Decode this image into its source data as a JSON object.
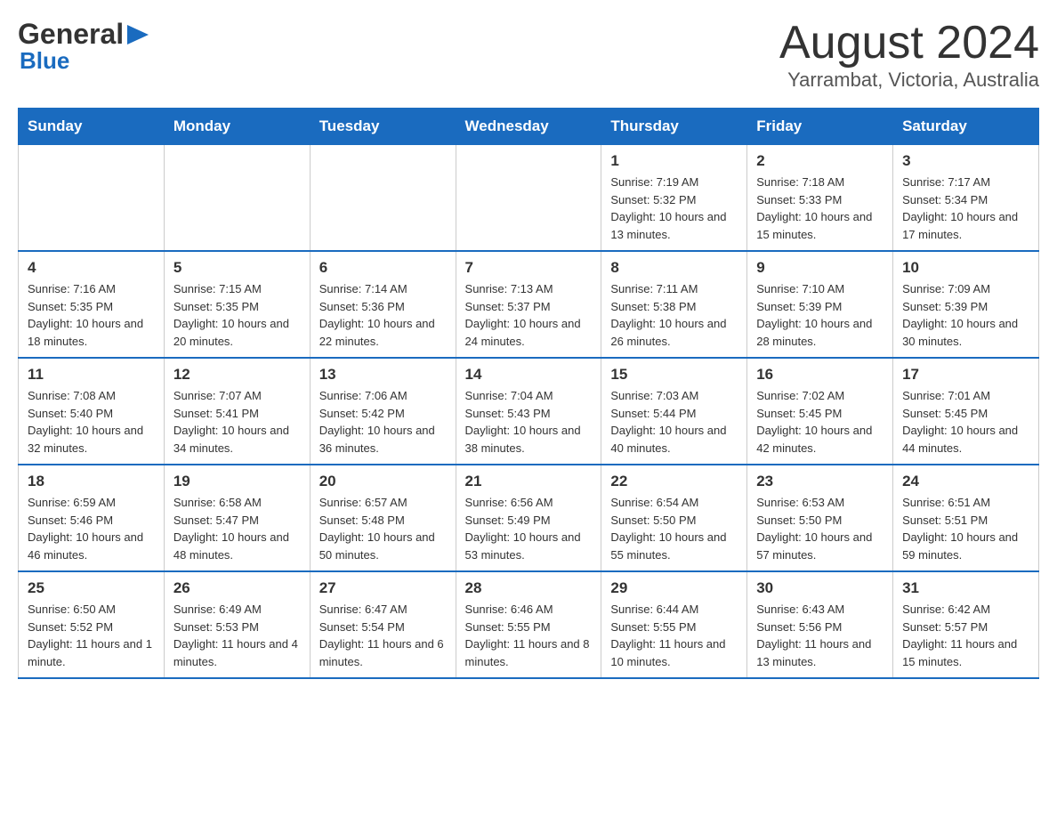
{
  "header": {
    "title": "August 2024",
    "subtitle": "Yarrambat, Victoria, Australia",
    "logo_general": "General",
    "logo_blue": "Blue"
  },
  "days_of_week": [
    "Sunday",
    "Monday",
    "Tuesday",
    "Wednesday",
    "Thursday",
    "Friday",
    "Saturday"
  ],
  "weeks": [
    {
      "days": [
        {
          "number": "",
          "info": ""
        },
        {
          "number": "",
          "info": ""
        },
        {
          "number": "",
          "info": ""
        },
        {
          "number": "",
          "info": ""
        },
        {
          "number": "1",
          "info": "Sunrise: 7:19 AM\nSunset: 5:32 PM\nDaylight: 10 hours and 13 minutes."
        },
        {
          "number": "2",
          "info": "Sunrise: 7:18 AM\nSunset: 5:33 PM\nDaylight: 10 hours and 15 minutes."
        },
        {
          "number": "3",
          "info": "Sunrise: 7:17 AM\nSunset: 5:34 PM\nDaylight: 10 hours and 17 minutes."
        }
      ]
    },
    {
      "days": [
        {
          "number": "4",
          "info": "Sunrise: 7:16 AM\nSunset: 5:35 PM\nDaylight: 10 hours and 18 minutes."
        },
        {
          "number": "5",
          "info": "Sunrise: 7:15 AM\nSunset: 5:35 PM\nDaylight: 10 hours and 20 minutes."
        },
        {
          "number": "6",
          "info": "Sunrise: 7:14 AM\nSunset: 5:36 PM\nDaylight: 10 hours and 22 minutes."
        },
        {
          "number": "7",
          "info": "Sunrise: 7:13 AM\nSunset: 5:37 PM\nDaylight: 10 hours and 24 minutes."
        },
        {
          "number": "8",
          "info": "Sunrise: 7:11 AM\nSunset: 5:38 PM\nDaylight: 10 hours and 26 minutes."
        },
        {
          "number": "9",
          "info": "Sunrise: 7:10 AM\nSunset: 5:39 PM\nDaylight: 10 hours and 28 minutes."
        },
        {
          "number": "10",
          "info": "Sunrise: 7:09 AM\nSunset: 5:39 PM\nDaylight: 10 hours and 30 minutes."
        }
      ]
    },
    {
      "days": [
        {
          "number": "11",
          "info": "Sunrise: 7:08 AM\nSunset: 5:40 PM\nDaylight: 10 hours and 32 minutes."
        },
        {
          "number": "12",
          "info": "Sunrise: 7:07 AM\nSunset: 5:41 PM\nDaylight: 10 hours and 34 minutes."
        },
        {
          "number": "13",
          "info": "Sunrise: 7:06 AM\nSunset: 5:42 PM\nDaylight: 10 hours and 36 minutes."
        },
        {
          "number": "14",
          "info": "Sunrise: 7:04 AM\nSunset: 5:43 PM\nDaylight: 10 hours and 38 minutes."
        },
        {
          "number": "15",
          "info": "Sunrise: 7:03 AM\nSunset: 5:44 PM\nDaylight: 10 hours and 40 minutes."
        },
        {
          "number": "16",
          "info": "Sunrise: 7:02 AM\nSunset: 5:45 PM\nDaylight: 10 hours and 42 minutes."
        },
        {
          "number": "17",
          "info": "Sunrise: 7:01 AM\nSunset: 5:45 PM\nDaylight: 10 hours and 44 minutes."
        }
      ]
    },
    {
      "days": [
        {
          "number": "18",
          "info": "Sunrise: 6:59 AM\nSunset: 5:46 PM\nDaylight: 10 hours and 46 minutes."
        },
        {
          "number": "19",
          "info": "Sunrise: 6:58 AM\nSunset: 5:47 PM\nDaylight: 10 hours and 48 minutes."
        },
        {
          "number": "20",
          "info": "Sunrise: 6:57 AM\nSunset: 5:48 PM\nDaylight: 10 hours and 50 minutes."
        },
        {
          "number": "21",
          "info": "Sunrise: 6:56 AM\nSunset: 5:49 PM\nDaylight: 10 hours and 53 minutes."
        },
        {
          "number": "22",
          "info": "Sunrise: 6:54 AM\nSunset: 5:50 PM\nDaylight: 10 hours and 55 minutes."
        },
        {
          "number": "23",
          "info": "Sunrise: 6:53 AM\nSunset: 5:50 PM\nDaylight: 10 hours and 57 minutes."
        },
        {
          "number": "24",
          "info": "Sunrise: 6:51 AM\nSunset: 5:51 PM\nDaylight: 10 hours and 59 minutes."
        }
      ]
    },
    {
      "days": [
        {
          "number": "25",
          "info": "Sunrise: 6:50 AM\nSunset: 5:52 PM\nDaylight: 11 hours and 1 minute."
        },
        {
          "number": "26",
          "info": "Sunrise: 6:49 AM\nSunset: 5:53 PM\nDaylight: 11 hours and 4 minutes."
        },
        {
          "number": "27",
          "info": "Sunrise: 6:47 AM\nSunset: 5:54 PM\nDaylight: 11 hours and 6 minutes."
        },
        {
          "number": "28",
          "info": "Sunrise: 6:46 AM\nSunset: 5:55 PM\nDaylight: 11 hours and 8 minutes."
        },
        {
          "number": "29",
          "info": "Sunrise: 6:44 AM\nSunset: 5:55 PM\nDaylight: 11 hours and 10 minutes."
        },
        {
          "number": "30",
          "info": "Sunrise: 6:43 AM\nSunset: 5:56 PM\nDaylight: 11 hours and 13 minutes."
        },
        {
          "number": "31",
          "info": "Sunrise: 6:42 AM\nSunset: 5:57 PM\nDaylight: 11 hours and 15 minutes."
        }
      ]
    }
  ]
}
